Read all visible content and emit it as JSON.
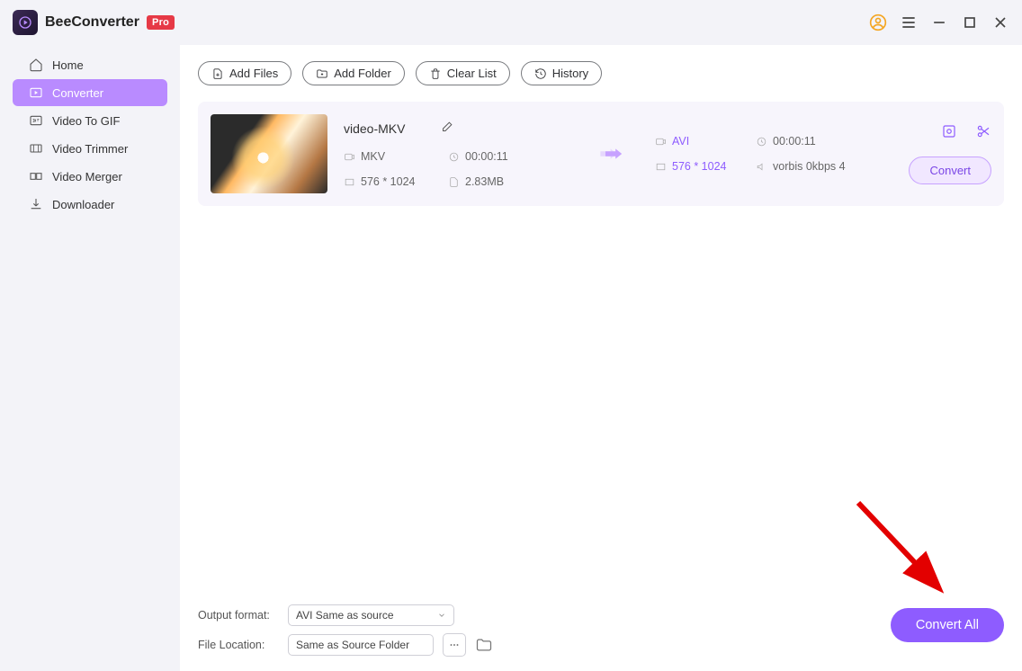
{
  "app": {
    "name": "BeeConverter",
    "badge": "Pro"
  },
  "sidebar": {
    "items": [
      {
        "label": "Home",
        "iconName": "home-icon"
      },
      {
        "label": "Converter",
        "iconName": "converter-icon"
      },
      {
        "label": "Video To GIF",
        "iconName": "video-to-gif-icon"
      },
      {
        "label": "Video Trimmer",
        "iconName": "trimmer-icon"
      },
      {
        "label": "Video Merger",
        "iconName": "merger-icon"
      },
      {
        "label": "Downloader",
        "iconName": "downloader-icon"
      }
    ],
    "activeIndex": 1
  },
  "toolbar": {
    "addFiles": "Add Files",
    "addFolder": "Add Folder",
    "clearList": "Clear List",
    "history": "History"
  },
  "file": {
    "title": "video-MKV",
    "source": {
      "format": "MKV",
      "duration": "00:00:11",
      "resolution": "576 * 1024",
      "size": "2.83MB"
    },
    "target": {
      "format": "AVI",
      "duration": "00:00:11",
      "resolution": "576 * 1024",
      "audio": "vorbis 0kbps 4"
    },
    "convertLabel": "Convert"
  },
  "footer": {
    "outputFormatLabel": "Output format:",
    "outputFormatValue": "AVI Same as source",
    "fileLocationLabel": "File Location:",
    "fileLocationValue": "Same as Source Folder",
    "convertAllLabel": "Convert All"
  }
}
